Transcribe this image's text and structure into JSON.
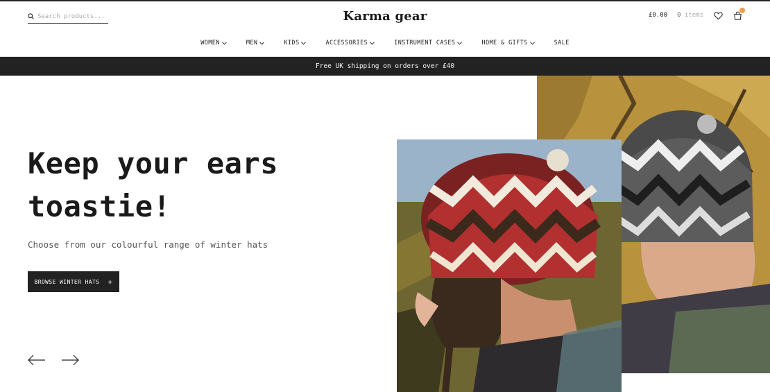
{
  "header": {
    "search_placeholder": "Search products...",
    "logo": "Karma gear",
    "cart_total": "£0.00",
    "items_count": "0",
    "items_label": "items"
  },
  "nav": {
    "items": [
      {
        "label": "WOMEN",
        "has_dropdown": true
      },
      {
        "label": "MEN",
        "has_dropdown": true
      },
      {
        "label": "KIDS",
        "has_dropdown": true
      },
      {
        "label": "ACCESSORIES",
        "has_dropdown": true
      },
      {
        "label": "INSTRUMENT CASES",
        "has_dropdown": true
      },
      {
        "label": "HOME & GIFTS",
        "has_dropdown": true
      },
      {
        "label": "SALE",
        "has_dropdown": false
      }
    ]
  },
  "promo": {
    "text": "Free UK shipping on orders over £40"
  },
  "hero": {
    "headline_line1": "Keep your ears",
    "headline_line2": "toastie!",
    "subtext": "Choose from our colourful range of winter hats",
    "cta_label": "BROWSE WINTER HATS",
    "cta_icon": "+"
  },
  "icons": {
    "search": "search-icon",
    "wishlist": "heart-icon",
    "cart": "bag-icon",
    "prev": "arrow-left-icon",
    "next": "arrow-right-icon",
    "dropdown": "chevron-down-icon"
  },
  "colors": {
    "dark": "#222222",
    "badge": "#f29b4b",
    "background": "#ffffff"
  }
}
